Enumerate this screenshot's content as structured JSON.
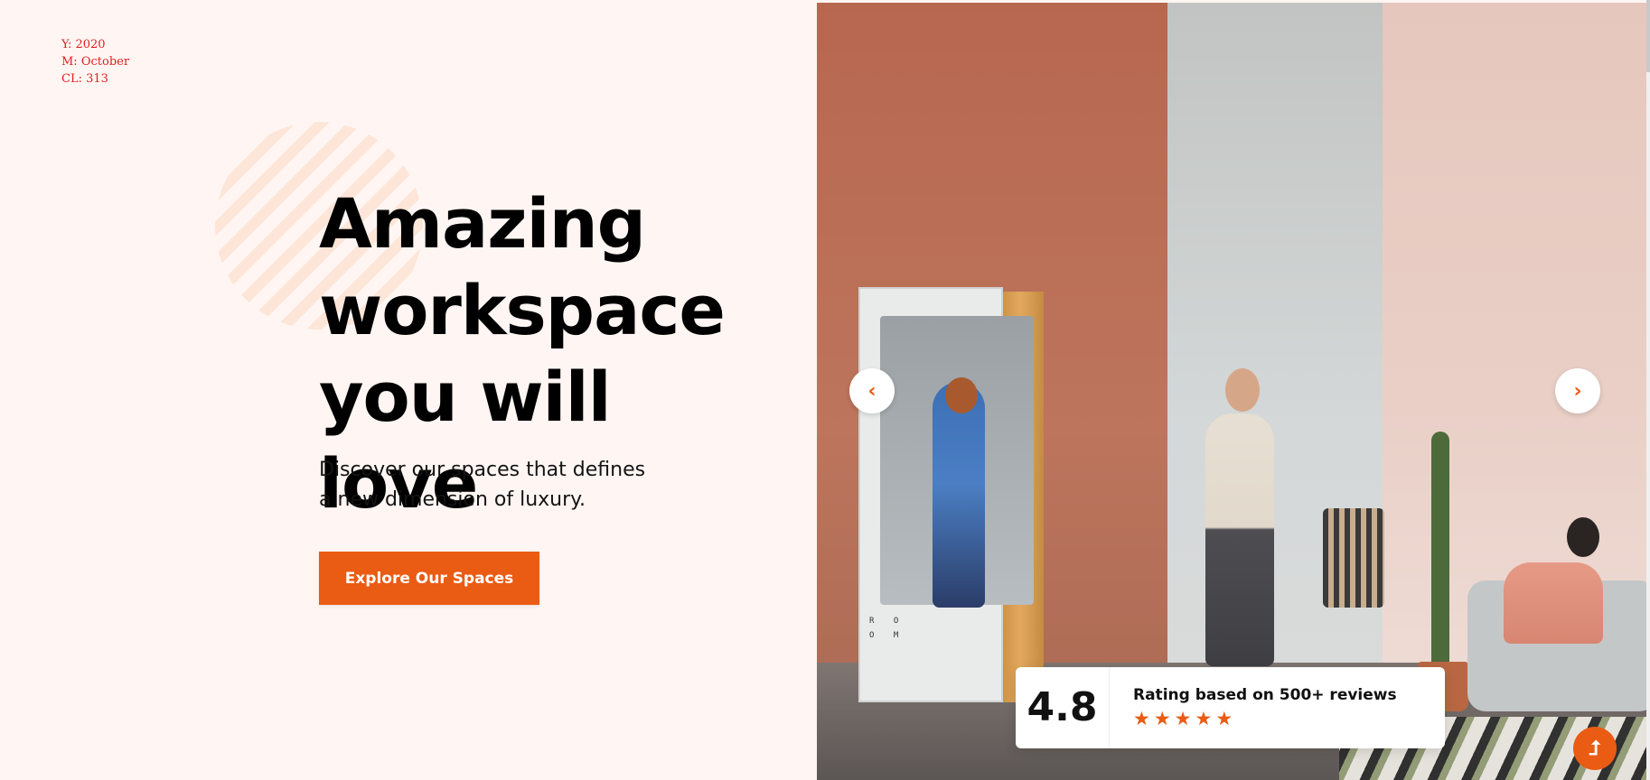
{
  "meta": {
    "year": "Y: 2020",
    "month": "M: October",
    "cl": "CL: 313"
  },
  "hero": {
    "title_line1": "Amazing",
    "title_line2": "workspace",
    "title_line3": "you will love",
    "subtitle_line1": "Discover our spaces that defines",
    "subtitle_line2": "a new dimension of luxury.",
    "cta_label": "Explore Our Spaces"
  },
  "slider": {
    "booth_text_line1": "R O",
    "booth_text_line2": "O M",
    "prev_icon": "chevron-left-icon",
    "next_icon": "chevron-right-icon",
    "prev_glyph": "‹",
    "next_glyph": "›"
  },
  "rating": {
    "score": "4.8",
    "label": "Rating based on 500+ reviews",
    "stars": 5,
    "star_glyph": "★"
  },
  "scroll_top": {
    "icon": "arrow-up-icon",
    "glyph": "⮥"
  },
  "colors": {
    "accent": "#ea5b14",
    "background": "#fff6f3",
    "text": "#000000"
  }
}
